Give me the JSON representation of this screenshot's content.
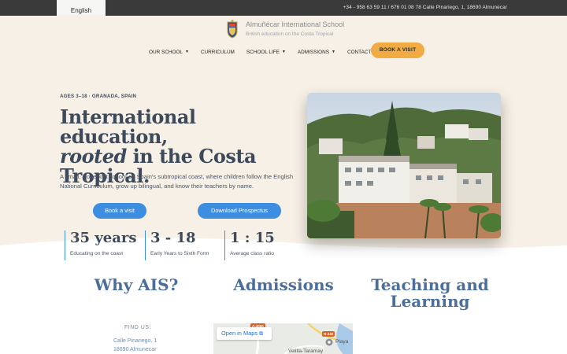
{
  "topbar": {
    "language": "English",
    "contact": "+34 - 958 63 59 11 / 676 01 08 78   Calle Pinariego, 1, 18690 Almunecar"
  },
  "header": {
    "school_name": "Almuñécar International School",
    "tagline": "British education on the Costa Tropical",
    "nav": [
      "OUR SCHOOL",
      "CURRICULUM",
      "SCHOOL LIFE",
      "ADMISSIONS",
      "CONTACT"
    ],
    "cta": "BOOK A VISIT"
  },
  "hero": {
    "eyebrow": "AGES 3–18 · GRANADA, SPAIN",
    "headline_line1": "International education,",
    "headline_em": "rooted",
    "headline_line2_rest": " in the Costa",
    "headline_line3": "Tropical.",
    "lede": "A small, close-knit school on Spain's subtropical coast, where children follow the English National Curriculum, grow up bilingual, and know their teachers by name.",
    "btn_visit": "Book a visit",
    "btn_prospectus": "Download Prospectus",
    "stats": [
      {
        "value": "35 years",
        "label": "Educating on the coast"
      },
      {
        "value": "3 - 18",
        "label": "Early Years to Sixth Form"
      },
      {
        "value": "1 : 15",
        "label": "Average class ratio"
      }
    ]
  },
  "sections": {
    "why": "Why AIS?",
    "admissions": "Admissions",
    "teaching_line1": "Teaching and",
    "teaching_line2": "Learning"
  },
  "footer": {
    "find_us": "FIND US:",
    "address_line1": "Calle Pinariego, 1",
    "address_line2": "18690 Almunecar"
  },
  "map": {
    "open_in_maps": "Open in Maps",
    "road_a": "A-4050",
    "road_n": "N-340",
    "place_playa": "Playa",
    "place_velilla": "Velilla-Taramay"
  },
  "colors": {
    "cream": "#f6f0e6",
    "navy_text": "#3d4a5c",
    "blue_button": "#3d8de0",
    "orange_cta": "#f0ac43",
    "section_heading": "#4b6e9a"
  }
}
